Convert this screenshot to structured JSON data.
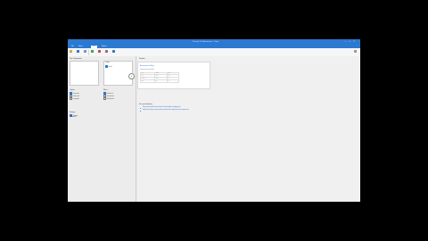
{
  "window": {
    "title": "Security Test Automation - Tester"
  },
  "tabs": [
    "File",
    "Home",
    "Run",
    "Report"
  ],
  "ribbon": {
    "buttons": [
      {
        "label": "Open",
        "icon": "folder-icon",
        "color": "#e0a82e"
      },
      {
        "label": "Save",
        "icon": "save-icon",
        "color": "#2b79d0"
      },
      {
        "label": "New",
        "icon": "new-icon",
        "color": "#6a9cd8"
      },
      {
        "label": "Run",
        "icon": "play-icon",
        "color": "#3aa655"
      },
      {
        "label": "Stop",
        "icon": "stop-icon",
        "color": "#d04a3a"
      },
      {
        "label": "Export",
        "icon": "export-icon",
        "color": "#7b7b7b"
      },
      {
        "label": "Help",
        "icon": "help-icon",
        "color": "#2b79d0"
      }
    ]
  },
  "left": {
    "scope_header": "Test Configuration",
    "targets_header": "Targets",
    "targets": [
      "Host 1"
    ],
    "options_header": "Options",
    "options": [
      {
        "label": "Scan ports",
        "checked": true
      },
      {
        "label": "Verify certs",
        "checked": false
      },
      {
        "label": "Log output",
        "checked": false
      }
    ],
    "filters_header": "Filters",
    "filters": [
      {
        "label": "Include all",
        "checked": true
      },
      {
        "label": "Exclude info",
        "checked": false
      },
      {
        "label": "Exclude low",
        "checked": false
      }
    ],
    "extra_header": "Settings",
    "extra": [
      {
        "label": "Verbose",
        "checked": true
      },
      {
        "label": "Timeout"
      }
    ]
  },
  "main": {
    "title": "Results",
    "card": {
      "heading": "Assessment Status",
      "subtitle": "Summary of executed tests",
      "rows": [
        [
          "Test",
          "Status",
          "Score"
        ],
        [
          "Auth",
          "Pass",
          "100"
        ],
        [
          "Session",
          "Pass",
          "98"
        ],
        [
          "Input",
          "Fail",
          "40"
        ]
      ]
    },
    "results_title": "Recommendations",
    "results_lines": [
      "Review input validation issues found in the form handlers and apply patch",
      "Enable secure flag on session cookies and rotate tokens regularly to reduce exposure risk"
    ]
  },
  "fab": {
    "label": "+"
  }
}
